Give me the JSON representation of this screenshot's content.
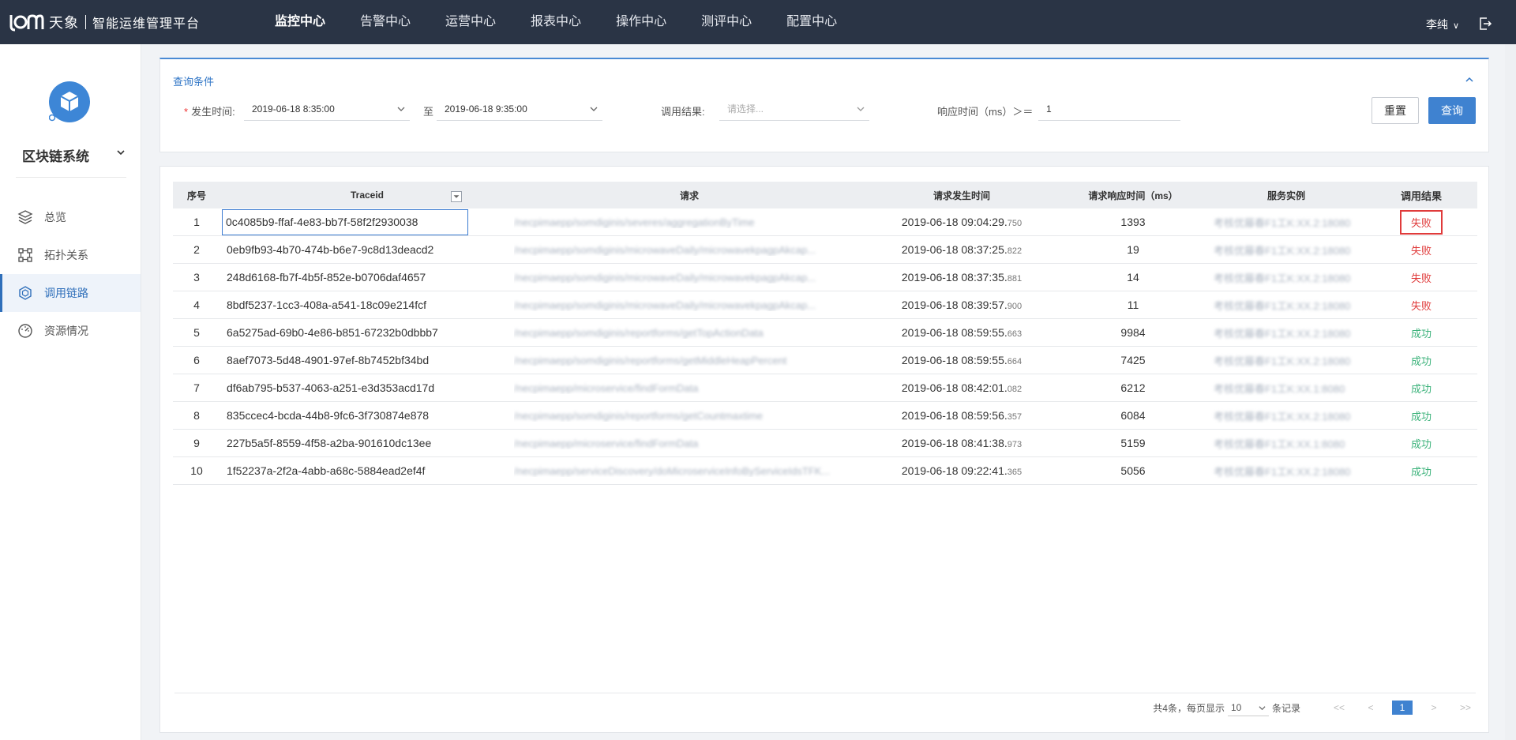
{
  "app": {
    "brand": "天象",
    "subtitle": "智能运维管理平台"
  },
  "nav": [
    {
      "label": "监控中心",
      "active": true
    },
    {
      "label": "告警中心"
    },
    {
      "label": "运营中心"
    },
    {
      "label": "报表中心"
    },
    {
      "label": "操作中心"
    },
    {
      "label": "测评中心"
    },
    {
      "label": "配置中心"
    }
  ],
  "user": {
    "name": "李纯"
  },
  "sidebar": {
    "system": "区块链系统",
    "items": [
      {
        "label": "总览",
        "icon": "layers-icon"
      },
      {
        "label": "拓扑关系",
        "icon": "topology-icon"
      },
      {
        "label": "调用链路",
        "icon": "cube-icon",
        "active": true
      },
      {
        "label": "资源情况",
        "icon": "gauge-icon"
      }
    ]
  },
  "query": {
    "title": "查询条件",
    "time_label": "发生时间:",
    "start_time": "2019-06-18 8:35:00",
    "to_label": "至",
    "end_time": "2019-06-18 9:35:00",
    "result_label": "调用结果:",
    "result_placeholder": "请选择...",
    "resp_label": "响应时间（ms）＞＝",
    "resp_value": "1",
    "reset": "重置",
    "search": "查询"
  },
  "table": {
    "headers": {
      "idx": "序号",
      "trace": "Traceid",
      "req": "请求",
      "time": "请求发生时间",
      "resp": "请求响应时间（ms）",
      "inst": "服务实例",
      "result": "调用结果"
    },
    "rows": [
      {
        "idx": "1",
        "trace": "0c4085b9-ffaf-4e83-bb7f-58f2f2930038",
        "req": "/necpimaepp/somdiginis/severes/aggregationByTime",
        "time": "2019-06-18 09:04:29.",
        "ms": "750",
        "resp": "1393",
        "inst": "考核优藤春F1工K:XX.2:18080",
        "result": "失败"
      },
      {
        "idx": "2",
        "trace": "0eb9fb93-4b70-474b-b6e7-9c8d13deacd2",
        "req": "/necpimaepp/somdiginis/microwaveDaily/microwavekpagpAkcap...",
        "time": "2019-06-18 08:37:25.",
        "ms": "822",
        "resp": "19",
        "inst": "考核优藤春F1工K:XX.2:18080",
        "result": "失败"
      },
      {
        "idx": "3",
        "trace": "248d6168-fb7f-4b5f-852e-b0706daf4657",
        "req": "/necpimaepp/somdiginis/microwaveDaily/microwavekpagpAkcap...",
        "time": "2019-06-18 08:37:35.",
        "ms": "881",
        "resp": "14",
        "inst": "考核优藤春F1工K:XX.2:18080",
        "result": "失败"
      },
      {
        "idx": "4",
        "trace": "8bdf5237-1cc3-408a-a541-18c09e214fcf",
        "req": "/necpimaepp/somdiginis/microwaveDaily/microwavekpagpAkcap...",
        "time": "2019-06-18 08:39:57.",
        "ms": "900",
        "resp": "11",
        "inst": "考核优藤春F1工K:XX.2:18080",
        "result": "失败"
      },
      {
        "idx": "5",
        "trace": "6a5275ad-69b0-4e86-b851-67232b0dbbb7",
        "req": "/necpimaepp/somdiginis/reportforms/getTopActionData",
        "time": "2019-06-18 08:59:55.",
        "ms": "663",
        "resp": "9984",
        "inst": "考核优藤春F1工K:XX.2:18080",
        "result": "成功"
      },
      {
        "idx": "6",
        "trace": "8aef7073-5d48-4901-97ef-8b7452bf34bd",
        "req": "/necpimaepp/somdiginis/reportforms/getMiddleHeapPercent",
        "time": "2019-06-18 08:59:55.",
        "ms": "664",
        "resp": "7425",
        "inst": "考核优藤春F1工K:XX.2:18080",
        "result": "成功"
      },
      {
        "idx": "7",
        "trace": "df6ab795-b537-4063-a251-e3d353acd17d",
        "req": "/necpimaepp/microservice/findFormData",
        "time": "2019-06-18 08:42:01.",
        "ms": "082",
        "resp": "6212",
        "inst": "考核优藤春F1工K:XX.1:8080",
        "result": "成功"
      },
      {
        "idx": "8",
        "trace": "835ccec4-bcda-44b8-9fc6-3f730874e878",
        "req": "/necpimaepp/somdiginis/reportforms/getCountmaxtime",
        "time": "2019-06-18 08:59:56.",
        "ms": "357",
        "resp": "6084",
        "inst": "考核优藤春F1工K:XX.2:18080",
        "result": "成功"
      },
      {
        "idx": "9",
        "trace": "227b5a5f-8559-4f58-a2ba-901610dc13ee",
        "req": "/necpimaepp/microservice/findFormData",
        "time": "2019-06-18 08:41:38.",
        "ms": "973",
        "resp": "5159",
        "inst": "考核优藤春F1工K:XX.1:8080",
        "result": "成功"
      },
      {
        "idx": "10",
        "trace": "1f52237a-2f2a-4abb-a68c-5884ead2ef4f",
        "req": "/necpimaepp/serviceDiscovery/doMicroserviceInfoByServiceIdsTFK...",
        "time": "2019-06-18 09:22:41.",
        "ms": "365",
        "resp": "5056",
        "inst": "考核优藤春F1工K:XX.2:18080",
        "result": "成功"
      }
    ]
  },
  "pager": {
    "summary": "共4条，每页显示",
    "size": "10",
    "unit": "条记录",
    "first": "<<",
    "prev": "<",
    "page": "1",
    "next": ">",
    "last": ">>"
  },
  "colors": {
    "topbar": "#2a3445",
    "accent": "#3f82d0",
    "fail": "#e03b3b",
    "ok": "#3bb27a"
  }
}
